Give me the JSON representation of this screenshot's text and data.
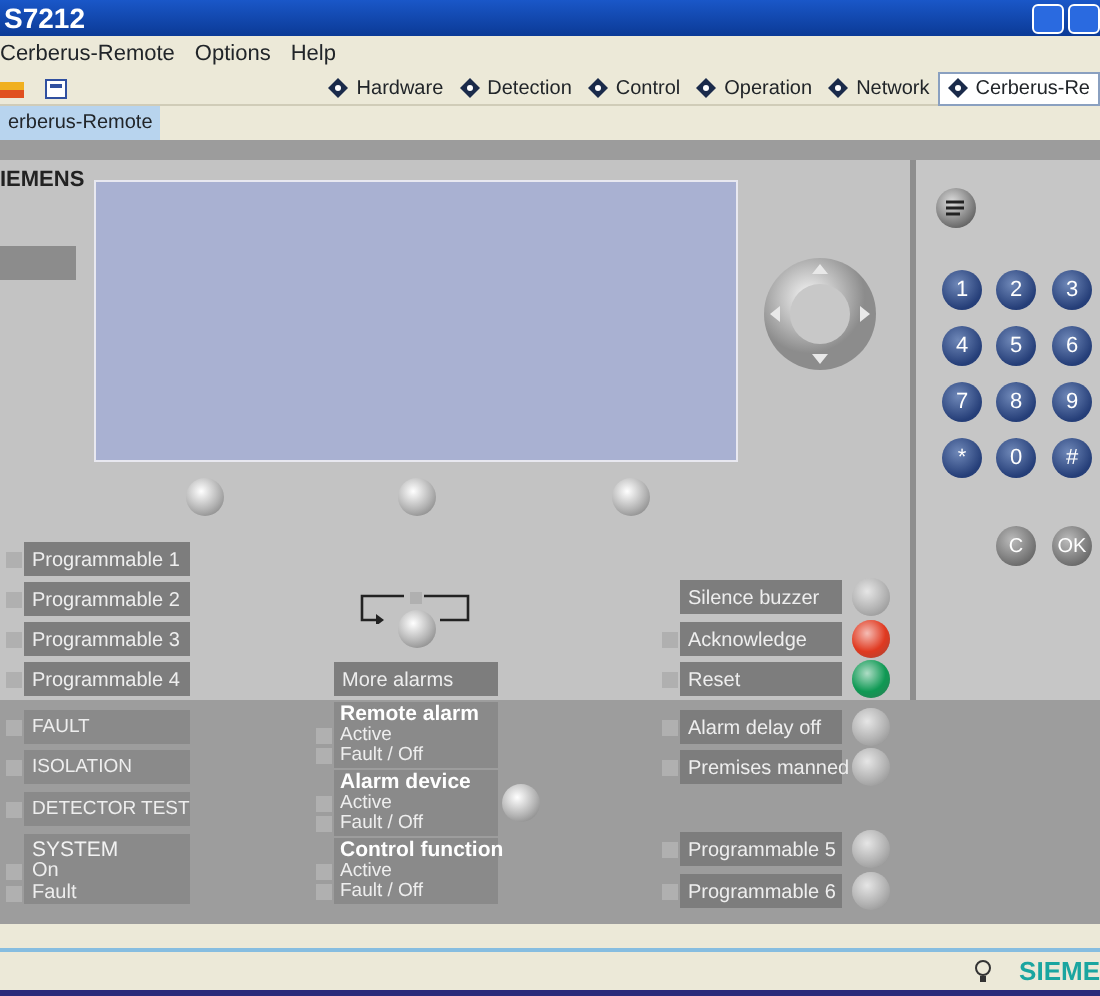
{
  "window": {
    "title": "S7212"
  },
  "menu": [
    "Cerberus-Remote",
    "Options",
    "Help"
  ],
  "nav": [
    {
      "label": "Hardware",
      "selected": false
    },
    {
      "label": "Detection",
      "selected": false
    },
    {
      "label": "Control",
      "selected": false
    },
    {
      "label": "Operation",
      "selected": false
    },
    {
      "label": "Network",
      "selected": false
    },
    {
      "label": "Cerberus-Re",
      "selected": true
    }
  ],
  "tabs": [
    {
      "label": "erberus-Remote",
      "selected": true
    }
  ],
  "panel": {
    "brand": "IEMENS",
    "left_buttons": [
      {
        "label": "Programmable 1"
      },
      {
        "label": "Programmable 2"
      },
      {
        "label": "Programmable 3"
      },
      {
        "label": "Programmable 4"
      }
    ],
    "more_alarms": "More alarms",
    "status_indicators": [
      {
        "label": "FAULT"
      },
      {
        "label": "ISOLATION"
      },
      {
        "label": "DETECTOR TEST"
      }
    ],
    "system": {
      "title": "SYSTEM",
      "items": [
        "On",
        "Fault"
      ]
    },
    "alarm_groups": [
      {
        "title": "Remote alarm",
        "items": [
          "Active",
          "Fault / Off"
        ]
      },
      {
        "title": "Alarm device",
        "items": [
          "Active",
          "Fault / Off"
        ]
      },
      {
        "title": "Control function",
        "items": [
          "Active",
          "Fault / Off"
        ]
      }
    ],
    "right_buttons": [
      {
        "label": "Silence buzzer",
        "indicator": false,
        "color": "#b4b4b4"
      },
      {
        "label": "Acknowledge",
        "indicator": true,
        "color": "#e03a20"
      },
      {
        "label": "Reset",
        "indicator": true,
        "color": "#109a55"
      },
      {
        "label": "Alarm delay off",
        "indicator": true,
        "color": "#b4b4b4"
      },
      {
        "label": "Premises manned",
        "indicator": true,
        "color": "#b4b4b4"
      },
      {
        "label": "Programmable 5",
        "indicator": true,
        "color": "#b4b4b4"
      },
      {
        "label": "Programmable 6",
        "indicator": true,
        "color": "#b4b4b4"
      }
    ],
    "keypad": {
      "keys": [
        "1",
        "2",
        "3",
        "4",
        "5",
        "6",
        "7",
        "8",
        "9",
        "*",
        "0",
        "#"
      ],
      "clear": "C",
      "ok": "OK"
    }
  },
  "status_bar": {
    "brand": "SIEME"
  }
}
